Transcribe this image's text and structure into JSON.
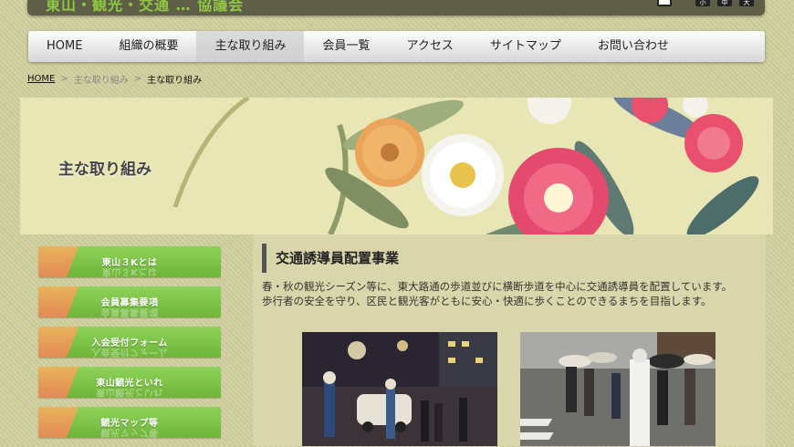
{
  "header": {
    "site_title": "東山・観光・交通 … 協議会",
    "tools": [
      "小",
      "中",
      "大"
    ]
  },
  "gnav": [
    {
      "label": "HOME"
    },
    {
      "label": "組織の概要"
    },
    {
      "label": "主な取り組み",
      "active": true
    },
    {
      "label": "会員一覧"
    },
    {
      "label": "アクセス"
    },
    {
      "label": "サイトマップ"
    },
    {
      "label": "お問い合わせ"
    }
  ],
  "breadcrumb": {
    "home": "HOME",
    "sep": ">",
    "mid": "主な取り組み",
    "current": "主な取り組み"
  },
  "hero": {
    "title": "主な取り組み"
  },
  "side": [
    {
      "label": "東山３Kとは"
    },
    {
      "label": "会員募集要項"
    },
    {
      "label": "入会受付フォーム"
    },
    {
      "label": "東山観光といれ"
    },
    {
      "label": "観光マップ等"
    }
  ],
  "main": {
    "heading": "交通誘導員配置事業",
    "lead_1": "春・秋の観光シーズン等に、東大路通の歩道並びに横断歩道を中心に交通誘導員を配置しています。",
    "lead_2": "歩行者の安全を守り、区民と観光客がともに安心・快適に歩くことのできるまちを目指します。"
  },
  "colors": {
    "nav_green": "#7bbf45",
    "accent_orange": "#e7a85a",
    "header_dark": "#5f5f48"
  }
}
